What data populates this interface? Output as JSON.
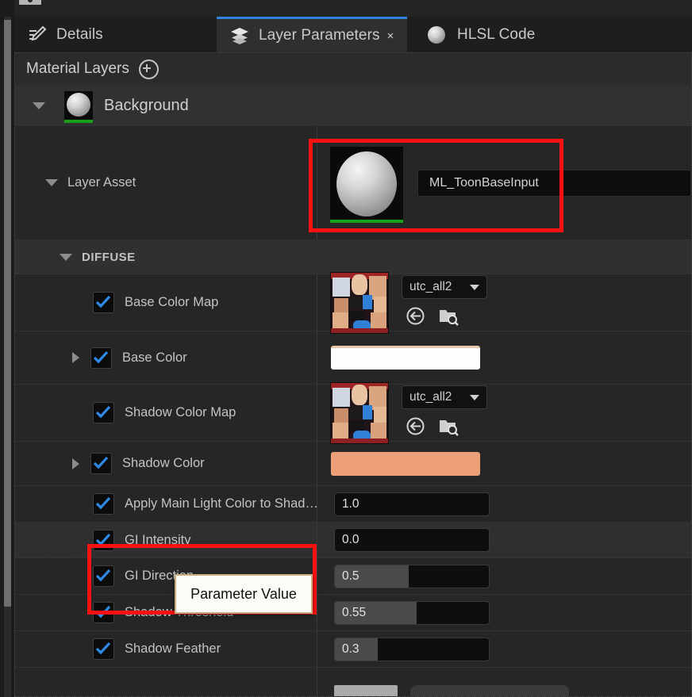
{
  "window": {
    "tabs": [
      {
        "label": "Details",
        "icon": "details-pencil-icon",
        "active": false,
        "closable": false
      },
      {
        "label": "Layer Parameters",
        "icon": "layers-stack-icon",
        "active": true,
        "closable": true,
        "close_label": "×"
      },
      {
        "label": "HLSL Code",
        "icon": "sphere-material-icon",
        "active": false,
        "closable": false
      }
    ]
  },
  "panel": {
    "header": {
      "title": "Material Layers",
      "add_icon": "plus-circle-icon"
    },
    "layer": {
      "name": "Background",
      "expanded": true,
      "thumbnail": "sphere-preview"
    },
    "layer_asset": {
      "label": "Layer Asset",
      "expanded": true,
      "asset_name": "ML_ToonBaseInput",
      "thumbnail": "sphere-preview"
    },
    "section": {
      "label": "DIFFUSE",
      "expanded": true
    },
    "rows": [
      {
        "label": "Base Color Map",
        "type": "texture",
        "checked": true,
        "expandable": false,
        "texture_name": "utc_all2",
        "icons": [
          "use-selected-asset-icon",
          "browse-to-asset-icon"
        ]
      },
      {
        "label": "Base Color",
        "type": "color",
        "checked": true,
        "expandable": true,
        "color": "#fefefe"
      },
      {
        "label": "Shadow Color Map",
        "type": "texture",
        "checked": true,
        "expandable": false,
        "texture_name": "utc_all2",
        "icons": [
          "use-selected-asset-icon",
          "browse-to-asset-icon"
        ]
      },
      {
        "label": "Shadow Color",
        "type": "color",
        "checked": true,
        "expandable": true,
        "color": "#eda077"
      },
      {
        "label": "Apply Main Light Color to Shad…",
        "type": "number",
        "checked": true,
        "expandable": false,
        "value": "1.0",
        "fill_pct": 0
      },
      {
        "label": "GI Intensity",
        "type": "number",
        "checked": true,
        "expandable": false,
        "value": "0.0",
        "fill_pct": 0,
        "highlighted": true
      },
      {
        "label": "GI Direction",
        "type": "number",
        "checked": true,
        "expandable": false,
        "value": "0.5",
        "fill_pct": 48,
        "highlighted": true
      },
      {
        "label": "Shadow Threshold",
        "type": "number",
        "checked": true,
        "expandable": false,
        "value": "0.55",
        "fill_pct": 53
      },
      {
        "label": "Shadow Feather",
        "type": "number",
        "checked": true,
        "expandable": false,
        "value": "0.3",
        "fill_pct": 28
      }
    ]
  },
  "tooltip": {
    "text": "Parameter Value"
  },
  "annotations": {
    "layer_asset_highlight": "red-callout-box",
    "gi_params_highlight": "red-callout-box"
  },
  "colors": {
    "accent_tab": "#2e84dd",
    "checkbox_check": "#2e8ae5",
    "annotation_red": "#fb1111",
    "thumbnail_green": "#18a018",
    "shadow_color_swatch": "#eda077",
    "base_color_swatch": "#fefefe"
  }
}
